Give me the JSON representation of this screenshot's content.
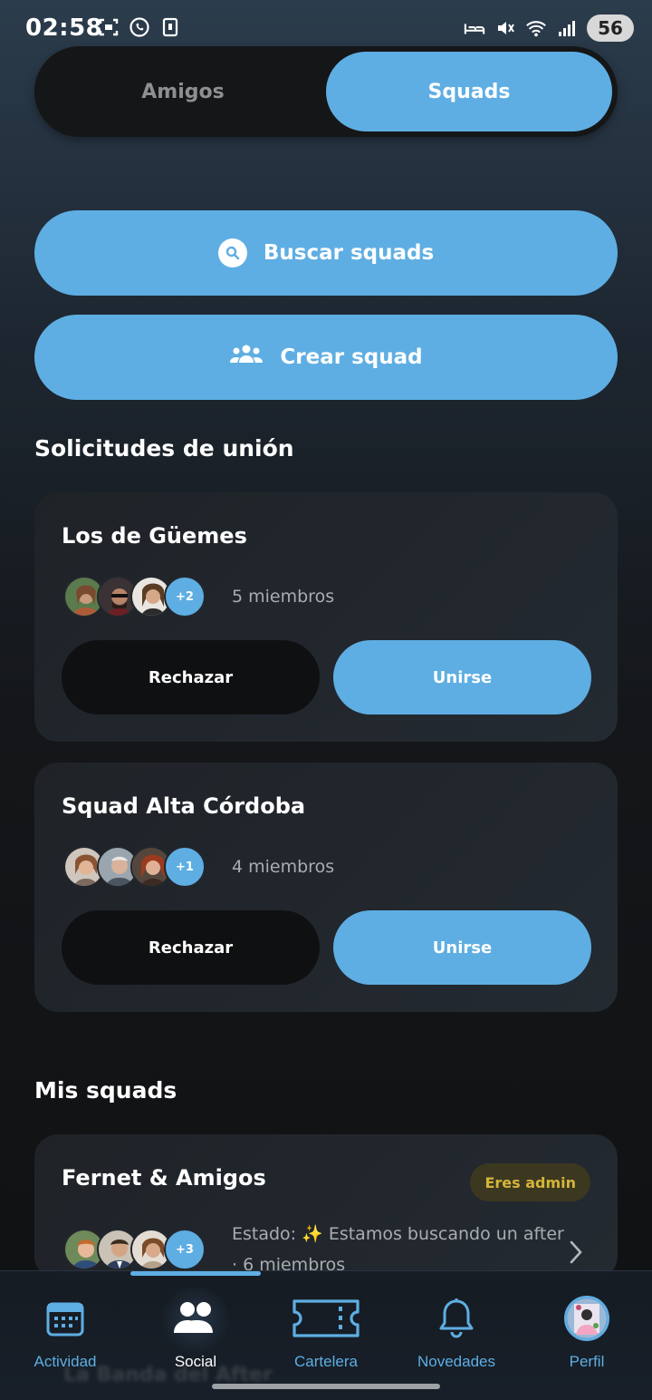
{
  "status_bar": {
    "time": "02:58",
    "battery": "56"
  },
  "segmented": {
    "tab_amigos": "Amigos",
    "tab_squads": "Squads",
    "active": "Squads"
  },
  "actions": {
    "search_label": "Buscar squads",
    "create_label": "Crear squad"
  },
  "requests": {
    "title": "Solicitudes de unión",
    "cards": [
      {
        "name": "Los de Güemes",
        "extra_members": "+2",
        "members": "5 miembros",
        "reject_label": "Rechazar",
        "join_label": "Unirse"
      },
      {
        "name": "Squad Alta Córdoba",
        "extra_members": "+1",
        "members": "4 miembros",
        "reject_label": "Rechazar",
        "join_label": "Unirse"
      }
    ]
  },
  "my_squads": {
    "title": "Mis squads",
    "cards": [
      {
        "name": "Fernet & Amigos",
        "badge": "Eres admin",
        "status": "Estado: ✨ Estamos buscando un after",
        "members": "· 6 miembros",
        "extra_members": "+3"
      }
    ],
    "next_card_name": "La Banda del After"
  },
  "bottom_nav": {
    "items": [
      {
        "label": "Actividad",
        "icon": "calendar-icon"
      },
      {
        "label": "Social",
        "icon": "group-icon"
      },
      {
        "label": "Cartelera",
        "icon": "ticket-icon"
      },
      {
        "label": "Novedades",
        "icon": "bell-icon"
      },
      {
        "label": "Perfil",
        "icon": "profile-avatar"
      }
    ],
    "active": "Social"
  },
  "colors": {
    "accent": "#5eaee3",
    "admin_badge_text": "#d5b53a",
    "card_bg": "#22272d"
  }
}
